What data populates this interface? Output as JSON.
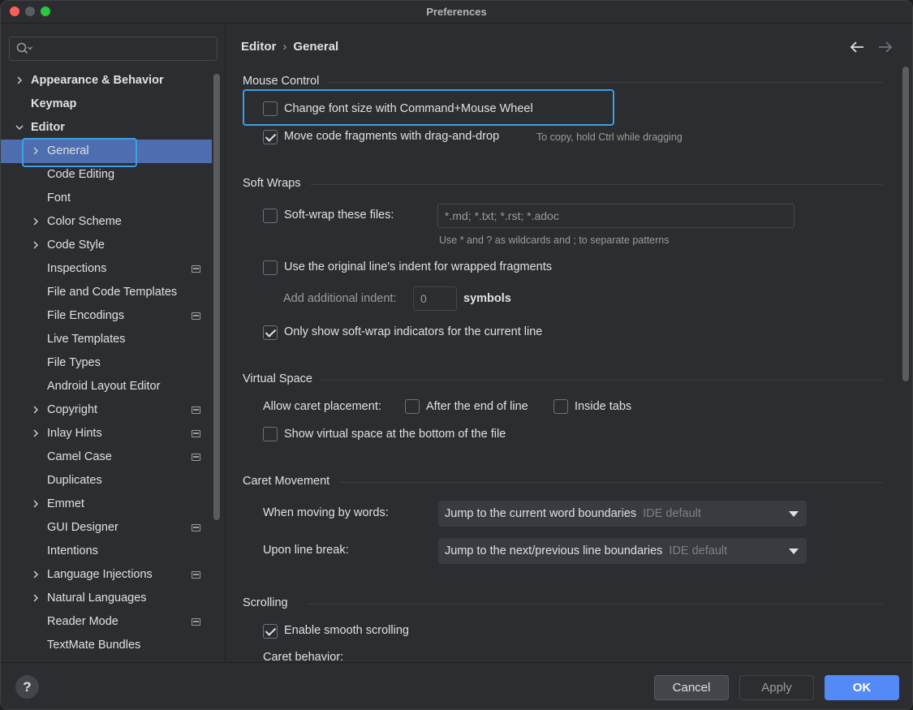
{
  "window": {
    "title": "Preferences"
  },
  "search": {
    "placeholder": ""
  },
  "tree": [
    {
      "label": "Appearance & Behavior",
      "level": 0,
      "bold": true,
      "expandable": true,
      "project": false
    },
    {
      "label": "Keymap",
      "level": 0,
      "bold": true,
      "expandable": false,
      "project": false
    },
    {
      "label": "Editor",
      "level": 0,
      "bold": true,
      "expandable": true,
      "expanded": true,
      "project": false
    },
    {
      "label": "General",
      "level": 1,
      "bold": false,
      "expandable": true,
      "selected": true,
      "project": false
    },
    {
      "label": "Code Editing",
      "level": 1,
      "expandable": false,
      "project": false
    },
    {
      "label": "Font",
      "level": 1,
      "expandable": false,
      "project": false
    },
    {
      "label": "Color Scheme",
      "level": 1,
      "expandable": true,
      "project": false
    },
    {
      "label": "Code Style",
      "level": 1,
      "expandable": true,
      "project": false
    },
    {
      "label": "Inspections",
      "level": 1,
      "expandable": false,
      "project": true
    },
    {
      "label": "File and Code Templates",
      "level": 1,
      "expandable": false,
      "project": false
    },
    {
      "label": "File Encodings",
      "level": 1,
      "expandable": false,
      "project": true
    },
    {
      "label": "Live Templates",
      "level": 1,
      "expandable": false,
      "project": false
    },
    {
      "label": "File Types",
      "level": 1,
      "expandable": false,
      "project": false
    },
    {
      "label": "Android Layout Editor",
      "level": 1,
      "expandable": false,
      "project": false
    },
    {
      "label": "Copyright",
      "level": 1,
      "expandable": true,
      "project": true
    },
    {
      "label": "Inlay Hints",
      "level": 1,
      "expandable": true,
      "project": true
    },
    {
      "label": "Camel Case",
      "level": 1,
      "expandable": false,
      "project": true
    },
    {
      "label": "Duplicates",
      "level": 1,
      "expandable": false,
      "project": false
    },
    {
      "label": "Emmet",
      "level": 1,
      "expandable": true,
      "project": false
    },
    {
      "label": "GUI Designer",
      "level": 1,
      "expandable": false,
      "project": true
    },
    {
      "label": "Intentions",
      "level": 1,
      "expandable": false,
      "project": false
    },
    {
      "label": "Language Injections",
      "level": 1,
      "expandable": true,
      "project": true
    },
    {
      "label": "Natural Languages",
      "level": 1,
      "expandable": true,
      "project": false
    },
    {
      "label": "Reader Mode",
      "level": 1,
      "expandable": false,
      "project": true
    },
    {
      "label": "TextMate Bundles",
      "level": 1,
      "expandable": false,
      "project": false
    }
  ],
  "breadcrumb": {
    "parent": "Editor",
    "separator": "›",
    "current": "General"
  },
  "mouse_control": {
    "title": "Mouse Control",
    "font_size_wheel": {
      "label": "Change font size with Command+Mouse Wheel",
      "checked": false
    },
    "drag_drop": {
      "label": "Move code fragments with drag-and-drop",
      "checked": true,
      "hint": "To copy, hold Ctrl while dragging"
    }
  },
  "soft_wraps": {
    "title": "Soft Wraps",
    "soft_wrap_files": {
      "label": "Soft-wrap these files:",
      "checked": false,
      "value": "*.md; *.txt; *.rst; *.adoc",
      "hint": "Use * and ? as wildcards and ; to separate patterns"
    },
    "original_indent": {
      "label": "Use the original line's indent for wrapped fragments",
      "checked": false
    },
    "additional_indent": {
      "label": "Add additional indent:",
      "value": "0",
      "unit": "symbols"
    },
    "indicators": {
      "label": "Only show soft-wrap indicators for the current line",
      "checked": true
    }
  },
  "virtual_space": {
    "title": "Virtual Space",
    "caret_label": "Allow caret placement:",
    "after_end": {
      "label": "After the end of line",
      "checked": false
    },
    "inside_tabs": {
      "label": "Inside tabs",
      "checked": false
    },
    "bottom": {
      "label": "Show virtual space at the bottom of the file",
      "checked": false
    }
  },
  "caret_movement": {
    "title": "Caret Movement",
    "words": {
      "label": "When moving by words:",
      "value": "Jump to the current word boundaries",
      "default": "IDE default"
    },
    "line_break": {
      "label": "Upon line break:",
      "value": "Jump to the next/previous line boundaries",
      "default": "IDE default"
    }
  },
  "scrolling": {
    "title": "Scrolling",
    "smooth": {
      "label": "Enable smooth scrolling",
      "checked": true
    },
    "caret_behavior": "Caret behavior:"
  },
  "footer": {
    "help": "?",
    "cancel": "Cancel",
    "apply": "Apply",
    "ok": "OK"
  },
  "colors": {
    "accent": "#548af7",
    "selection": "#4e6eb0",
    "focus": "#3d9fe6",
    "background": "#2b2d30"
  }
}
